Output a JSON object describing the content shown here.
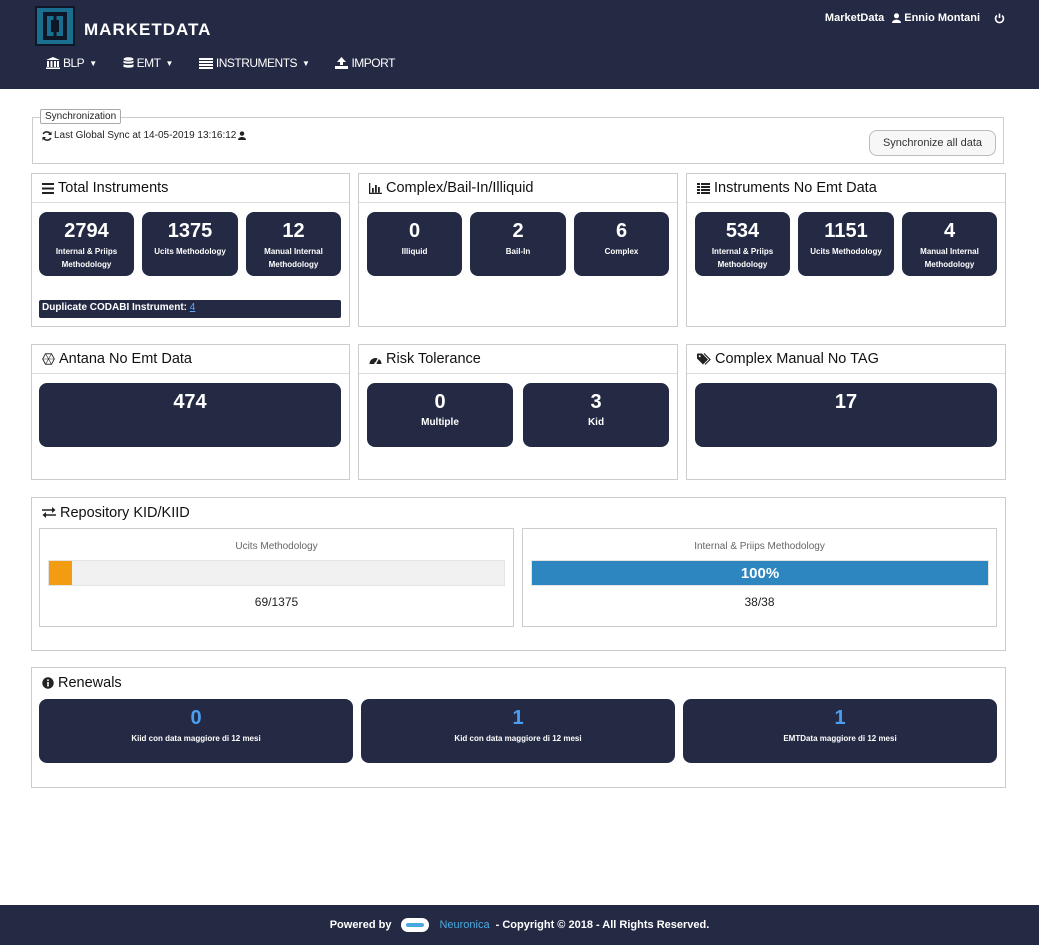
{
  "header": {
    "brand": "MARKETDATA",
    "app_link": "MarketData",
    "user": "Ennio Montani",
    "nav": [
      {
        "label": "BLP",
        "icon": "bank-icon",
        "caret": true
      },
      {
        "label": "EMT",
        "icon": "database-icon",
        "caret": true
      },
      {
        "label": "INSTRUMENTS",
        "icon": "list-icon",
        "caret": true
      },
      {
        "label": "IMPORT",
        "icon": "upload-icon",
        "caret": false
      }
    ]
  },
  "sync": {
    "legend": "Synchronization",
    "text": "Last Global Sync at 14-05-2019 13:16:12",
    "button": "Synchronize all data"
  },
  "total_instruments": {
    "title": "Total Instruments",
    "tiles": [
      {
        "num": "2794",
        "lbl": "Internal & Priips Methodology"
      },
      {
        "num": "1375",
        "lbl": "Ucits Methodology"
      },
      {
        "num": "12",
        "lbl": "Manual Internal Methodology"
      }
    ],
    "dup_label": "Duplicate CODABI Instrument:",
    "dup_value": "4"
  },
  "complex": {
    "title": "Complex/Bail-In/Illiquid",
    "tiles": [
      {
        "num": "0",
        "lbl": "Illiquid"
      },
      {
        "num": "2",
        "lbl": "Bail-In"
      },
      {
        "num": "6",
        "lbl": "Complex"
      }
    ]
  },
  "no_emt": {
    "title": "Instruments No Emt Data",
    "tiles": [
      {
        "num": "534",
        "lbl": "Internal & Priips Methodology"
      },
      {
        "num": "1151",
        "lbl": "Ucits Methodology"
      },
      {
        "num": "4",
        "lbl": "Manual Internal Methodology"
      }
    ]
  },
  "antana": {
    "title": "Antana No Emt Data",
    "num": "474"
  },
  "risk": {
    "title": "Risk Tolerance",
    "tiles": [
      {
        "num": "0",
        "lbl": "Multiple"
      },
      {
        "num": "3",
        "lbl": "Kid"
      }
    ]
  },
  "complex_manual": {
    "title": "Complex Manual No TAG",
    "num": "17"
  },
  "repository": {
    "title": "Repository KID/KIID",
    "ucits": {
      "caption": "Ucits Methodology",
      "count": "69/1375",
      "fraction": 0.05,
      "color": "#f39c12"
    },
    "internal": {
      "caption": "Internal & Priips Methodology",
      "count": "38/38",
      "fraction": 1.0,
      "percent_label": "100%",
      "color": "#2e86c1"
    }
  },
  "renewals": {
    "title": "Renewals",
    "tiles": [
      {
        "num": "0",
        "lbl": "Kiid con data maggiore di 12 mesi"
      },
      {
        "num": "1",
        "lbl": "Kid con data maggiore di 12 mesi"
      },
      {
        "num": "1",
        "lbl": "EMTData maggiore di 12 mesi"
      }
    ]
  },
  "footer": {
    "powered": "Powered by",
    "brand": "Neuronica",
    "copyright": "-  Copyright © 2018  -  All Rights Reserved."
  }
}
